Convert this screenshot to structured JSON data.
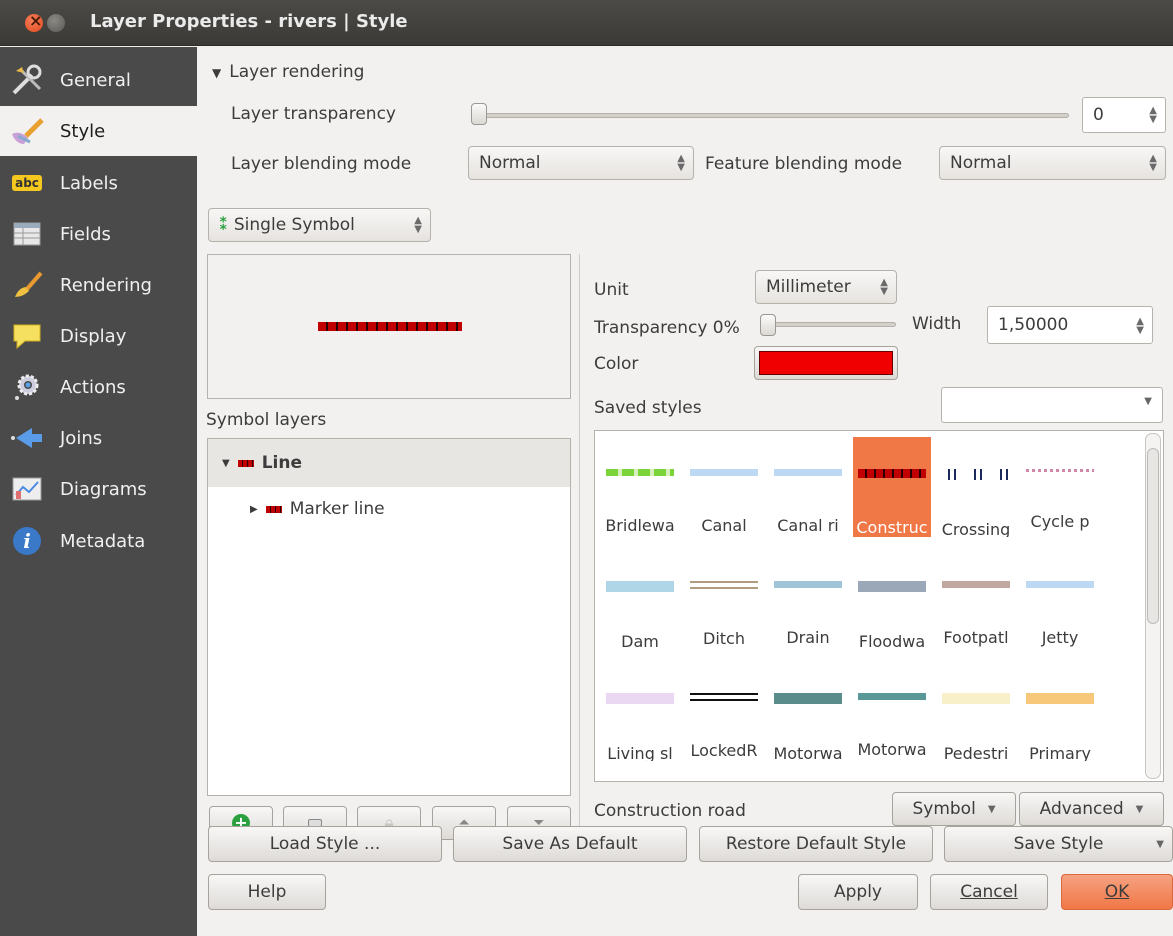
{
  "window": {
    "title": "Layer Properties - rivers | Style"
  },
  "sidebar": {
    "items": [
      {
        "label": "General",
        "icon": "tools-icon"
      },
      {
        "label": "Style",
        "icon": "brush-icon"
      },
      {
        "label": "Labels",
        "icon": "abc-labels-icon"
      },
      {
        "label": "Fields",
        "icon": "table-icon"
      },
      {
        "label": "Rendering",
        "icon": "brush-rendering-icon"
      },
      {
        "label": "Display",
        "icon": "speech-bubble-icon"
      },
      {
        "label": "Actions",
        "icon": "gear-icon"
      },
      {
        "label": "Joins",
        "icon": "joins-arrow-icon"
      },
      {
        "label": "Diagrams",
        "icon": "diagram-icon"
      },
      {
        "label": "Metadata",
        "icon": "info-icon"
      }
    ],
    "active": "Style"
  },
  "rendering": {
    "section_title": "Layer rendering",
    "transparency_label": "Layer transparency",
    "transparency_value": "0",
    "transparency_level": 0,
    "blending_label": "Layer blending mode",
    "blending_value": "Normal",
    "feature_blending_label": "Feature blending mode",
    "feature_blending_value": "Normal"
  },
  "renderer": {
    "type": "Single Symbol"
  },
  "symbol_layers": {
    "title": "Symbol layers",
    "tree": [
      {
        "label": "Line",
        "expanded": true
      },
      {
        "label": "Marker line",
        "expanded": false
      }
    ]
  },
  "symbol_props": {
    "unit_label": "Unit",
    "unit_value": "Millimeter",
    "transparency_label": "Transparency 0%",
    "width_label": "Width",
    "width_value": "1,50000",
    "color_label": "Color",
    "color_value": "#f00000",
    "saved_styles_label": "Saved styles"
  },
  "styles": [
    {
      "name": "Bridlewa",
      "color": "#7ad43a",
      "kind": "dashed"
    },
    {
      "name": "Canal",
      "color": "#bcd8f2",
      "kind": "solid"
    },
    {
      "name": "Canal ri",
      "color": "#bcd8f2",
      "kind": "solid"
    },
    {
      "name": "Construc",
      "color": "#c00000",
      "kind": "marker"
    },
    {
      "name": "Crossing",
      "color": "#1a2a5a",
      "kind": "squares"
    },
    {
      "name": "Cycle p",
      "color": "#d088a8",
      "kind": "dotted"
    },
    {
      "name": "Dam",
      "color": "#aed6e6",
      "kind": "thick"
    },
    {
      "name": "Ditch",
      "color": "#b09a80",
      "kind": "double"
    },
    {
      "name": "Drain",
      "color": "#9fc4d8",
      "kind": "solid"
    },
    {
      "name": "Floodwa",
      "color": "#9aa8b8",
      "kind": "thick"
    },
    {
      "name": "Footpatl",
      "color": "#c0a8a0",
      "kind": "solid"
    },
    {
      "name": "Jetty",
      "color": "#bcd8f2",
      "kind": "solid"
    },
    {
      "name": "Living sl",
      "color": "#ead8f2",
      "kind": "thick"
    },
    {
      "name": "LockedR",
      "color": "#111111",
      "kind": "double"
    },
    {
      "name": "Motorwa",
      "color": "#5a8c8c",
      "kind": "thick"
    },
    {
      "name": "Motorwa",
      "color": "#5a9898",
      "kind": "solid"
    },
    {
      "name": "Pedestri",
      "color": "#f8f0c8",
      "kind": "thick"
    },
    {
      "name": "Primary",
      "color": "#f8c87a",
      "kind": "thick"
    }
  ],
  "selected_style_name": "Construction road",
  "symbol_buttons": {
    "symbol": "Symbol",
    "advanced": "Advanced"
  },
  "footer": {
    "load_style": "Load Style ...",
    "save_as_default": "Save As Default",
    "restore_default": "Restore Default Style",
    "save_style": "Save Style",
    "help": "Help",
    "apply": "Apply",
    "cancel": "Cancel",
    "ok": "OK"
  },
  "colors": {
    "accent": "#f07746",
    "sidebar": "#4a4a4a",
    "titlebar": "#3c3b37"
  }
}
